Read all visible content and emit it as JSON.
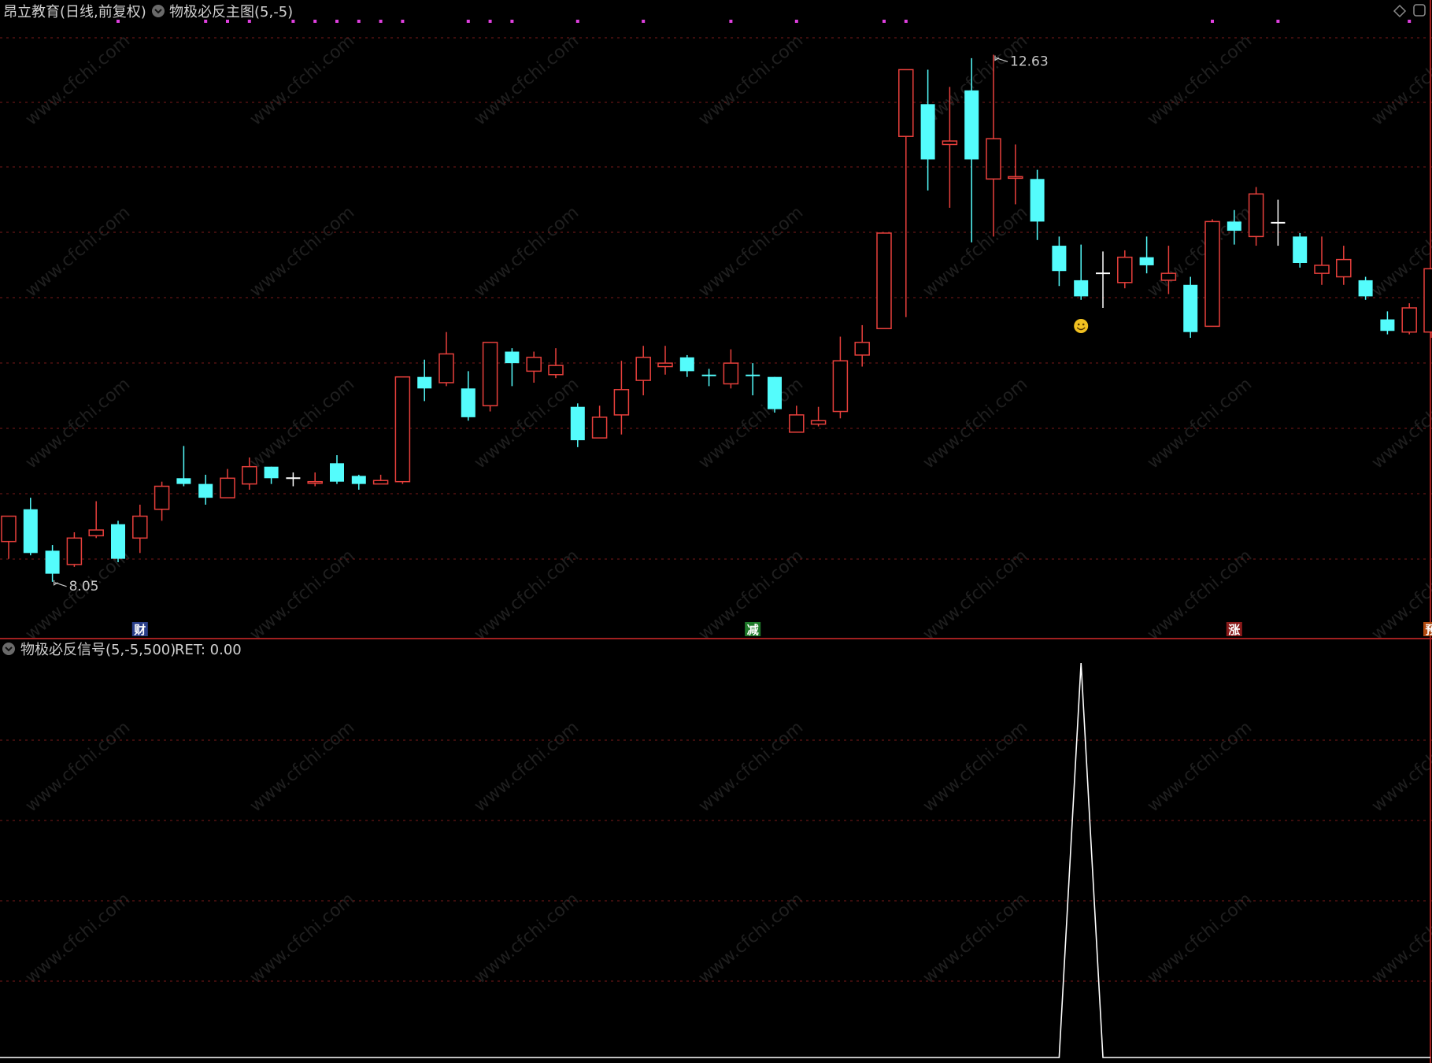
{
  "main_header": {
    "title": "昂立教育(日线,前复权)",
    "indicator": "物极必反主图(5,-5)"
  },
  "sub_header": {
    "indicator": "物极必反信号(5,-5,500)",
    "ret_label": "RET: 0.00"
  },
  "watermark": "www.cfchi.com",
  "colors": {
    "up": "#e8403c",
    "down": "#54fcfc",
    "doji": "#ffffff",
    "grid": "#7a1a1a",
    "separator": "#a02020",
    "dots": "#e040e0",
    "signal_line": "#ffffff"
  },
  "chart_data": [
    {
      "type": "candlestick",
      "price_range": [
        7.7,
        12.9
      ],
      "annotations": [
        {
          "label": "12.63",
          "bar": 45,
          "value": 12.63,
          "kind": "high"
        },
        {
          "label": "8.05",
          "bar": 2,
          "value": 8.05,
          "kind": "low"
        }
      ],
      "bars": [
        {
          "o": 8.4,
          "h": 8.62,
          "c": 8.62,
          "l": 8.25,
          "dir": "up"
        },
        {
          "o": 8.68,
          "h": 8.78,
          "c": 8.3,
          "l": 8.28,
          "dir": "down"
        },
        {
          "o": 8.32,
          "h": 8.37,
          "c": 8.12,
          "l": 8.05,
          "dir": "down"
        },
        {
          "o": 8.2,
          "h": 8.48,
          "c": 8.43,
          "l": 8.18,
          "dir": "up"
        },
        {
          "o": 8.45,
          "h": 8.75,
          "c": 8.5,
          "l": 8.43,
          "dir": "up"
        },
        {
          "o": 8.55,
          "h": 8.58,
          "c": 8.25,
          "l": 8.22,
          "dir": "down"
        },
        {
          "o": 8.43,
          "h": 8.72,
          "c": 8.62,
          "l": 8.3,
          "dir": "up"
        },
        {
          "o": 8.68,
          "h": 8.92,
          "c": 8.88,
          "l": 8.58,
          "dir": "up"
        },
        {
          "o": 8.95,
          "h": 9.23,
          "c": 8.9,
          "l": 8.88,
          "dir": "down"
        },
        {
          "o": 8.9,
          "h": 8.98,
          "c": 8.78,
          "l": 8.72,
          "dir": "down"
        },
        {
          "o": 8.78,
          "h": 9.03,
          "c": 8.95,
          "l": 8.78,
          "dir": "up"
        },
        {
          "o": 8.9,
          "h": 9.13,
          "c": 9.05,
          "l": 8.85,
          "dir": "up"
        },
        {
          "o": 9.05,
          "h": 9.05,
          "c": 8.95,
          "l": 8.9,
          "dir": "down"
        },
        {
          "o": 8.95,
          "h": 9.0,
          "c": 8.95,
          "l": 8.88,
          "dir": "doji"
        },
        {
          "o": 8.92,
          "h": 9.0,
          "c": 8.92,
          "l": 8.88,
          "dir": "up"
        },
        {
          "o": 9.08,
          "h": 9.15,
          "c": 8.92,
          "l": 8.9,
          "dir": "down"
        },
        {
          "o": 8.97,
          "h": 8.98,
          "c": 8.9,
          "l": 8.85,
          "dir": "down"
        },
        {
          "o": 8.9,
          "h": 8.98,
          "c": 8.93,
          "l": 8.9,
          "dir": "up"
        },
        {
          "o": 8.92,
          "h": 9.83,
          "c": 9.83,
          "l": 8.9,
          "dir": "up"
        },
        {
          "o": 9.83,
          "h": 9.98,
          "c": 9.73,
          "l": 9.62,
          "dir": "down"
        },
        {
          "o": 9.78,
          "h": 10.22,
          "c": 10.03,
          "l": 9.75,
          "dir": "up"
        },
        {
          "o": 9.73,
          "h": 9.88,
          "c": 9.48,
          "l": 9.45,
          "dir": "down"
        },
        {
          "o": 9.58,
          "h": 10.13,
          "c": 10.13,
          "l": 9.53,
          "dir": "up"
        },
        {
          "o": 10.05,
          "h": 10.08,
          "c": 9.95,
          "l": 9.75,
          "dir": "down"
        },
        {
          "o": 9.88,
          "h": 10.05,
          "c": 10.0,
          "l": 9.78,
          "dir": "up"
        },
        {
          "o": 9.85,
          "h": 10.08,
          "c": 9.93,
          "l": 9.82,
          "dir": "up"
        },
        {
          "o": 9.57,
          "h": 9.6,
          "c": 9.28,
          "l": 9.22,
          "dir": "down"
        },
        {
          "o": 9.3,
          "h": 9.58,
          "c": 9.48,
          "l": 9.3,
          "dir": "up"
        },
        {
          "o": 9.5,
          "h": 9.97,
          "c": 9.72,
          "l": 9.33,
          "dir": "up"
        },
        {
          "o": 9.8,
          "h": 10.1,
          "c": 10.0,
          "l": 9.67,
          "dir": "up"
        },
        {
          "o": 9.92,
          "h": 10.1,
          "c": 9.95,
          "l": 9.85,
          "dir": "up"
        },
        {
          "o": 10.0,
          "h": 10.02,
          "c": 9.88,
          "l": 9.83,
          "dir": "down"
        },
        {
          "o": 9.85,
          "h": 9.9,
          "c": 9.85,
          "l": 9.75,
          "dir": "down"
        },
        {
          "o": 9.77,
          "h": 10.07,
          "c": 9.95,
          "l": 9.73,
          "dir": "up"
        },
        {
          "o": 9.85,
          "h": 9.95,
          "c": 9.85,
          "l": 9.67,
          "dir": "down"
        },
        {
          "o": 9.83,
          "h": 9.83,
          "c": 9.55,
          "l": 9.52,
          "dir": "down"
        },
        {
          "o": 9.35,
          "h": 9.58,
          "c": 9.5,
          "l": 9.35,
          "dir": "up"
        },
        {
          "o": 9.42,
          "h": 9.57,
          "c": 9.45,
          "l": 9.4,
          "dir": "up"
        },
        {
          "o": 9.53,
          "h": 10.18,
          "c": 9.97,
          "l": 9.47,
          "dir": "up"
        },
        {
          "o": 10.02,
          "h": 10.28,
          "c": 10.13,
          "l": 9.92,
          "dir": "up"
        },
        {
          "o": 10.25,
          "h": 11.08,
          "c": 11.08,
          "l": 10.25,
          "dir": "up"
        },
        {
          "o": 11.92,
          "h": 12.5,
          "c": 12.5,
          "l": 10.35,
          "dir": "up"
        },
        {
          "o": 12.2,
          "h": 12.5,
          "c": 11.72,
          "l": 11.45,
          "dir": "down"
        },
        {
          "o": 11.85,
          "h": 12.35,
          "c": 11.88,
          "l": 11.3,
          "dir": "up"
        },
        {
          "o": 12.32,
          "h": 12.6,
          "c": 11.72,
          "l": 11.0,
          "dir": "down"
        },
        {
          "o": 11.55,
          "h": 12.63,
          "c": 11.9,
          "l": 11.05,
          "dir": "up"
        },
        {
          "o": 11.57,
          "h": 11.85,
          "c": 11.57,
          "l": 11.33,
          "dir": "up"
        },
        {
          "o": 11.55,
          "h": 11.63,
          "c": 11.18,
          "l": 11.02,
          "dir": "down"
        },
        {
          "o": 10.97,
          "h": 11.05,
          "c": 10.75,
          "l": 10.62,
          "dir": "down"
        },
        {
          "o": 10.67,
          "h": 10.98,
          "c": 10.53,
          "l": 10.5,
          "dir": "down"
        },
        {
          "o": 10.73,
          "h": 10.92,
          "c": 10.73,
          "l": 10.43,
          "dir": "doji"
        },
        {
          "o": 10.65,
          "h": 10.93,
          "c": 10.87,
          "l": 10.6,
          "dir": "up"
        },
        {
          "o": 10.87,
          "h": 11.05,
          "c": 10.8,
          "l": 10.73,
          "dir": "down"
        },
        {
          "o": 10.67,
          "h": 10.97,
          "c": 10.73,
          "l": 10.55,
          "dir": "up"
        },
        {
          "o": 10.63,
          "h": 10.7,
          "c": 10.22,
          "l": 10.17,
          "dir": "down"
        },
        {
          "o": 10.27,
          "h": 11.2,
          "c": 11.18,
          "l": 10.27,
          "dir": "up"
        },
        {
          "o": 11.18,
          "h": 11.28,
          "c": 11.1,
          "l": 10.98,
          "dir": "down"
        },
        {
          "o": 11.05,
          "h": 11.48,
          "c": 11.42,
          "l": 10.97,
          "dir": "up"
        },
        {
          "o": 11.17,
          "h": 11.37,
          "c": 11.17,
          "l": 10.97,
          "dir": "doji"
        },
        {
          "o": 11.05,
          "h": 11.08,
          "c": 10.82,
          "l": 10.78,
          "dir": "down"
        },
        {
          "o": 10.73,
          "h": 11.05,
          "c": 10.8,
          "l": 10.63,
          "dir": "up"
        },
        {
          "o": 10.7,
          "h": 10.97,
          "c": 10.85,
          "l": 10.63,
          "dir": "up"
        },
        {
          "o": 10.67,
          "h": 10.7,
          "c": 10.53,
          "l": 10.5,
          "dir": "down"
        },
        {
          "o": 10.33,
          "h": 10.4,
          "c": 10.23,
          "l": 10.2,
          "dir": "down"
        },
        {
          "o": 10.22,
          "h": 10.47,
          "c": 10.43,
          "l": 10.2,
          "dir": "up"
        },
        {
          "o": 10.22,
          "h": 10.57,
          "c": 10.77,
          "l": 10.17,
          "dir": "up"
        }
      ],
      "signal_tags": [
        {
          "label": "财",
          "bar": 6,
          "bg": "#2a3f8a",
          "fg": "#ffffff"
        },
        {
          "label": "减",
          "bar": 34,
          "bg": "#1f7a2a",
          "fg": "#ffffff"
        },
        {
          "label": "涨",
          "bar": 56,
          "bg": "#8a1a1a",
          "fg": "#ffffff"
        },
        {
          "label": "预",
          "bar": 65,
          "bg": "#b04a10",
          "fg": "#ffffff"
        }
      ],
      "marker": {
        "icon": "smiley-icon",
        "bar": 49,
        "value": 10.43
      },
      "top_dot_bars": [
        5,
        9,
        10,
        11,
        13,
        14,
        15,
        16,
        17,
        18,
        21,
        22,
        23,
        26,
        29,
        33,
        36,
        40,
        41,
        55,
        58,
        64
      ]
    },
    {
      "type": "line",
      "name": "RET",
      "range": [
        0,
        500
      ],
      "points": [
        {
          "bar": 0,
          "value": 0
        },
        {
          "bar": 48,
          "value": 0
        },
        {
          "bar": 49,
          "value": 500
        },
        {
          "bar": 50,
          "value": 0
        },
        {
          "bar": 65,
          "value": 0
        }
      ]
    }
  ]
}
